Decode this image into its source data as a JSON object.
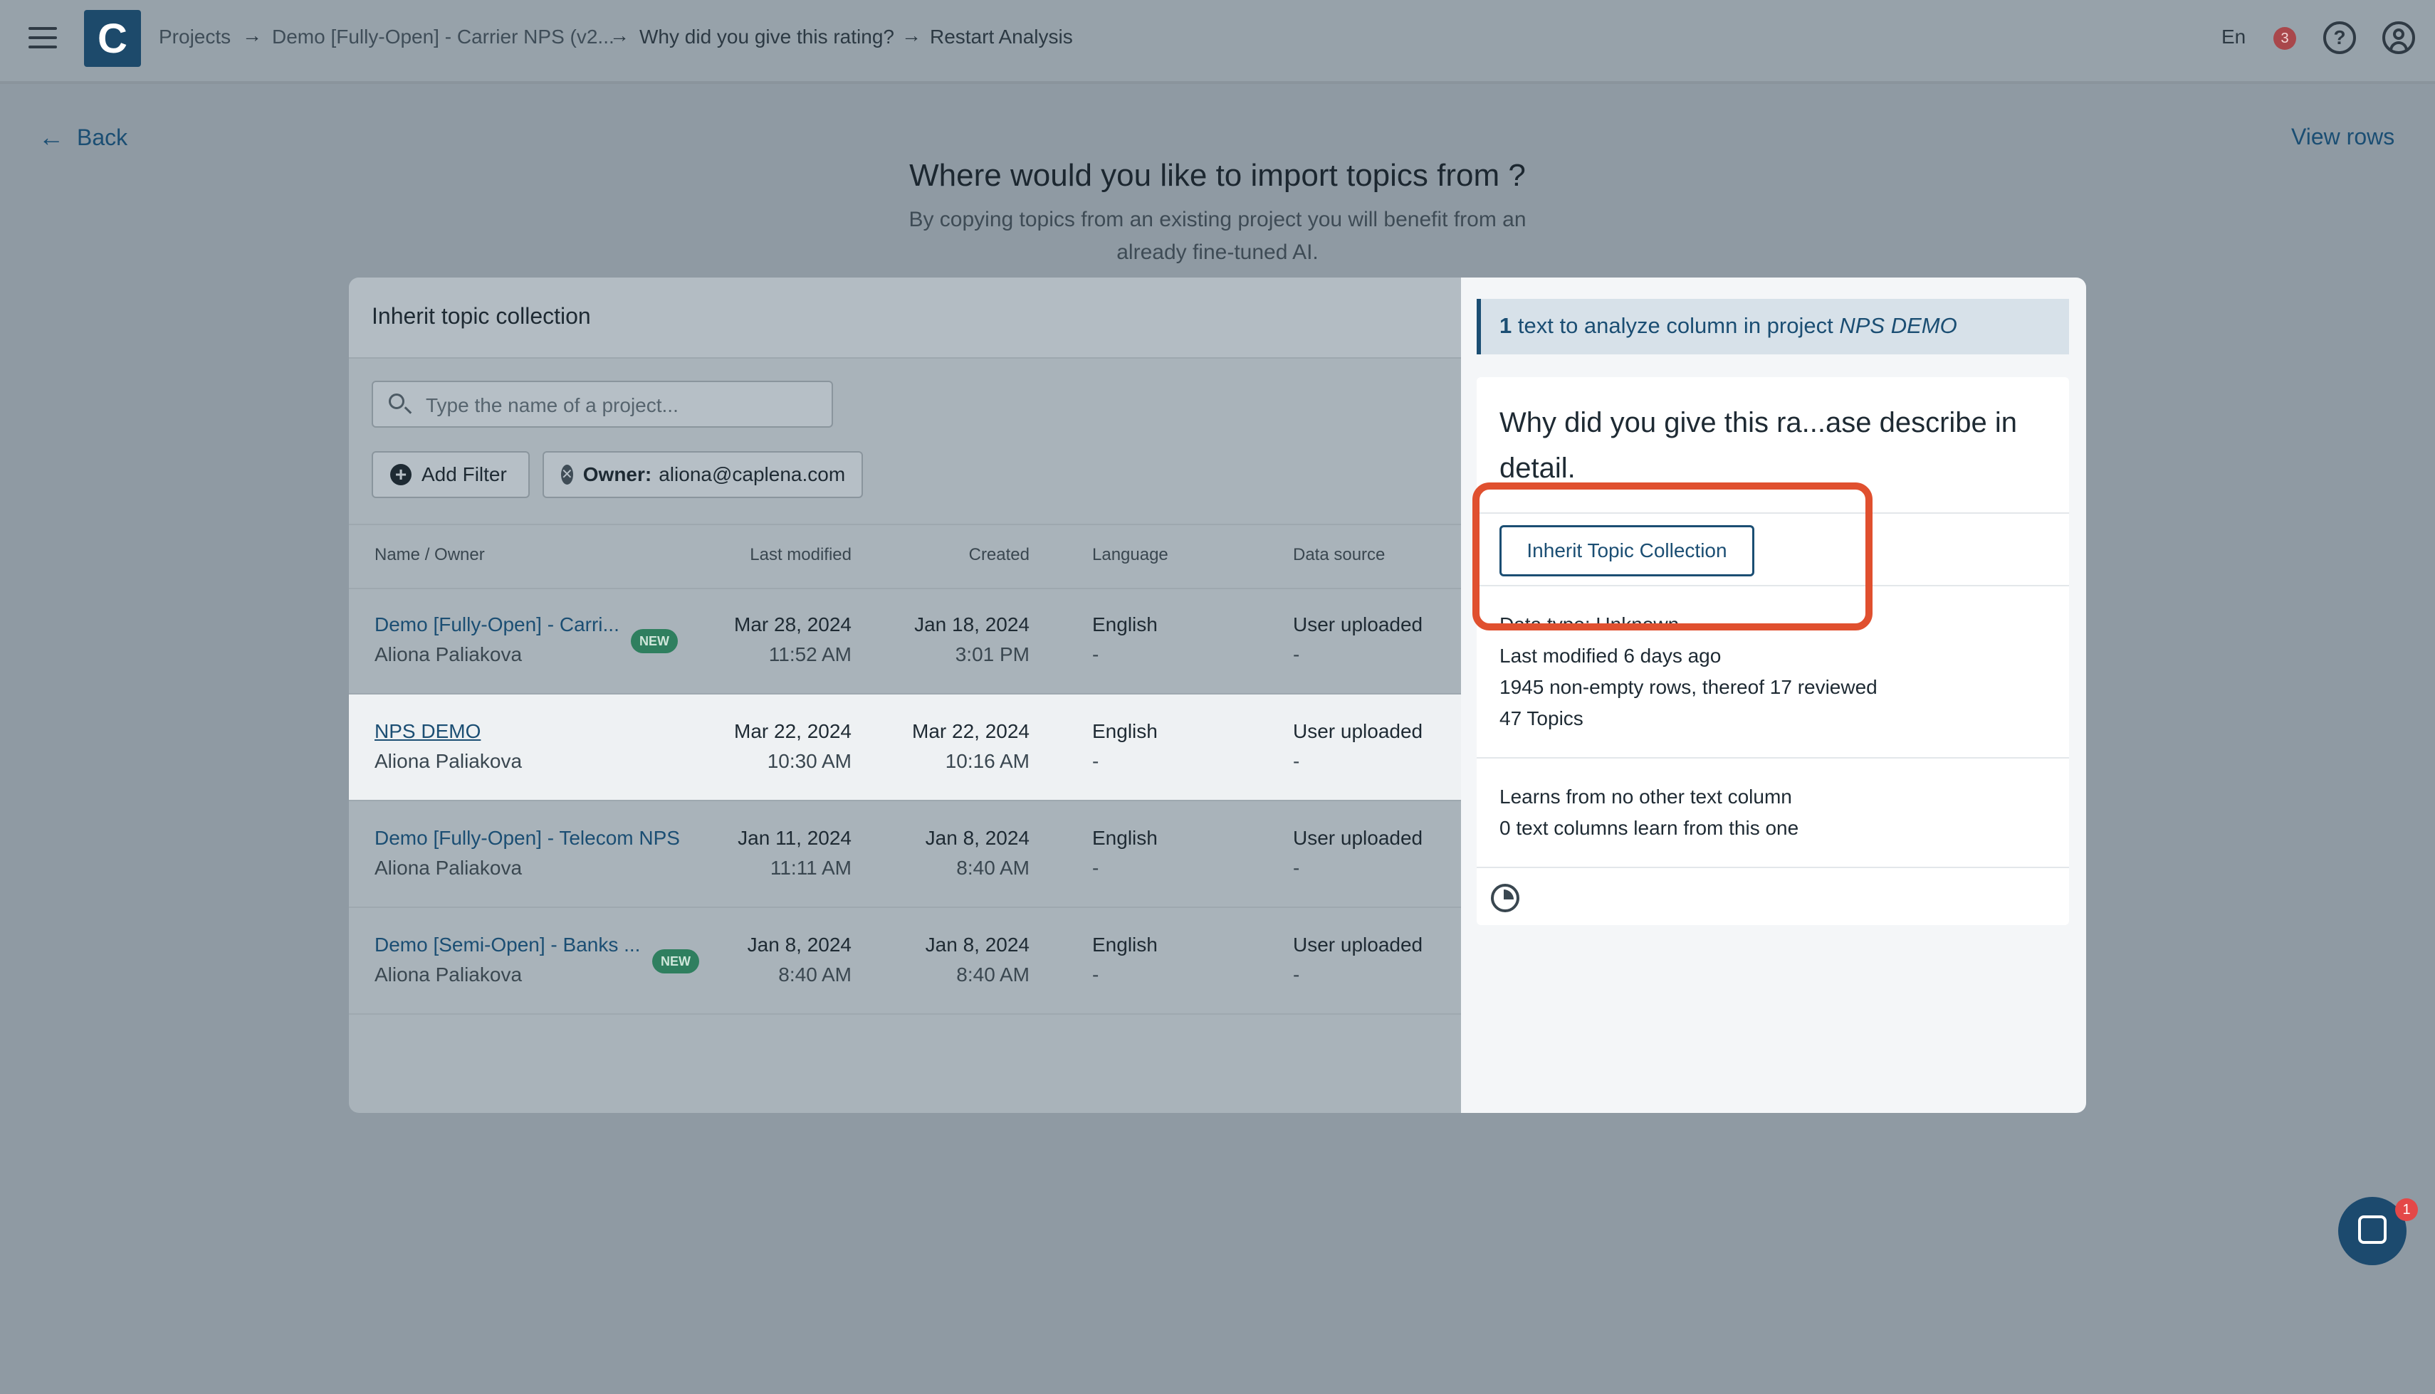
{
  "header": {
    "logo_letter": "C",
    "breadcrumbs": [
      "Projects",
      "Demo [Fully-Open] - Carrier NPS (v2...",
      "Why did you give this rating?",
      "Restart Analysis"
    ],
    "breadcrumb_separator": "→",
    "language": "En",
    "notification_count": "3",
    "help_symbol": "?"
  },
  "nav": {
    "back_label": "Back",
    "back_arrow": "←",
    "view_rows_label": "View rows"
  },
  "page": {
    "title": "Where would you like to import topics from ?",
    "subtitle": "By copying topics from an existing project you will benefit from an already fine-tuned AI."
  },
  "left": {
    "title": "Inherit topic collection",
    "search_placeholder": "Type the name of a project...",
    "add_filter_label": "Add Filter",
    "add_filter_symbol": "+",
    "owner_filter_key": "Owner:",
    "owner_filter_value": "aliona@caplena.com",
    "owner_filter_remove_symbol": "✕",
    "columns": [
      "Name / Owner",
      "Last modified",
      "Created",
      "Language",
      "Data source"
    ],
    "rows": [
      {
        "name": "Demo [Fully-Open] - Carri...",
        "owner": "Aliona Paliakova",
        "badge": "NEW",
        "modified_date": "Mar 28, 2024",
        "modified_time": "11:52 AM",
        "created_date": "Jan 18, 2024",
        "created_time": "3:01 PM",
        "language": "English",
        "language_sub": "-",
        "source": "User uploaded",
        "source_sub": "-"
      },
      {
        "name": "NPS DEMO",
        "owner": "Aliona Paliakova",
        "badge": "",
        "modified_date": "Mar 22, 2024",
        "modified_time": "10:30 AM",
        "created_date": "Mar 22, 2024",
        "created_time": "10:16 AM",
        "language": "English",
        "language_sub": "-",
        "source": "User uploaded",
        "source_sub": "-"
      },
      {
        "name": "Demo [Fully-Open] - Telecom NPS",
        "owner": "Aliona Paliakova",
        "badge": "",
        "modified_date": "Jan 11, 2024",
        "modified_time": "11:11 AM",
        "created_date": "Jan 8, 2024",
        "created_time": "8:40 AM",
        "language": "English",
        "language_sub": "-",
        "source": "User uploaded",
        "source_sub": "-"
      },
      {
        "name": "Demo [Semi-Open] - Banks ...",
        "owner": "Aliona Paliakova",
        "badge": "NEW",
        "modified_date": "Jan 8, 2024",
        "modified_time": "8:40 AM",
        "created_date": "Jan 8, 2024",
        "created_time": "8:40 AM",
        "language": "English",
        "language_sub": "-",
        "source": "User uploaded",
        "source_sub": "-"
      }
    ]
  },
  "right": {
    "info_count": "1",
    "info_text": "text to analyze column in project",
    "info_project": "NPS DEMO",
    "question_title": "Why did you give this ra...ase describe in detail.",
    "inherit_button_label": "Inherit Topic Collection",
    "data_type": "Data type: Unknown",
    "last_modified": "Last modified 6 days ago",
    "rows_info": "1945 non-empty rows, thereof 17 reviewed",
    "topics": "47 Topics",
    "learns_from": "Learns from no other text column",
    "learned_by": "0 text columns learn from this one"
  },
  "chat": {
    "badge_count": "1"
  },
  "colors": {
    "accent": "#1b4e73",
    "highlight": "#e0502f",
    "badge_green": "#2f7f5f",
    "notification_red": "#a9474b"
  }
}
